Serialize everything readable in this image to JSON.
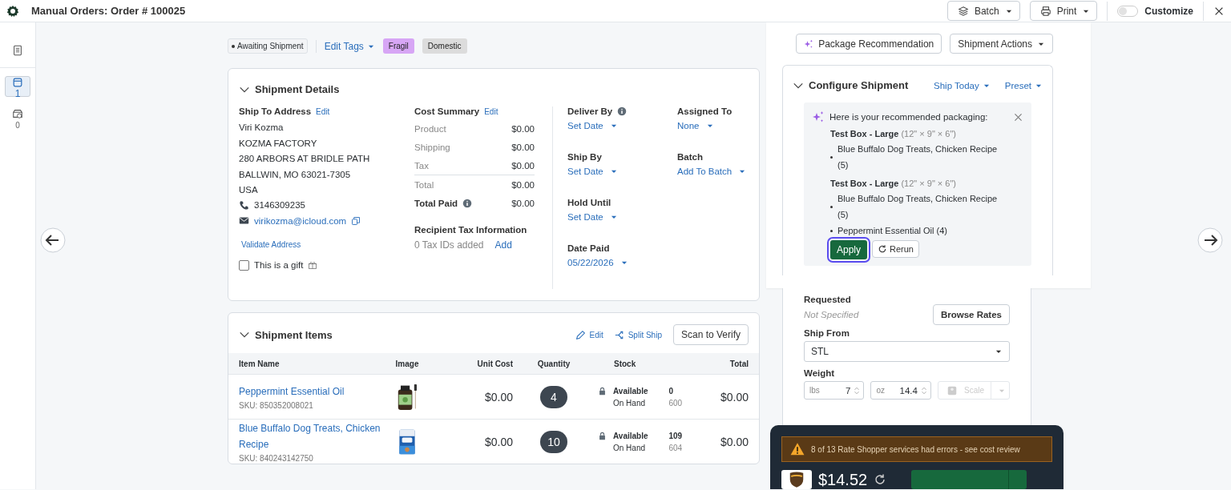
{
  "header": {
    "prefix": "Manual Orders:",
    "title": "Order # 100025",
    "buttons": [
      {
        "kind": "batch",
        "label": "Batch"
      },
      {
        "kind": "print",
        "label": "Print"
      }
    ],
    "customize": {
      "label": "Customize",
      "on": false
    }
  },
  "nav": [
    {
      "kind": "document",
      "selected": false
    },
    {
      "kind": "calendar",
      "count": "1",
      "selected": true
    },
    {
      "kind": "return",
      "count": "0",
      "selected": false
    }
  ],
  "status": "Awaiting Shipment",
  "edit_tags": "Edit Tags",
  "tags": [
    {
      "label": "Fragil",
      "color": "#d7a6f5"
    },
    {
      "label": "Domestic",
      "color": "#dcdcdc"
    }
  ],
  "shipment_details": {
    "title": "Shipment Details",
    "ship_to": {
      "label": "Ship To Address",
      "edit": "Edit",
      "lines": [
        "Viri Kozma",
        "KOZMA FACTORY",
        "280 ARBORS AT BRIDLE PATH",
        "BALLWIN, MO 63021-7305",
        "USA"
      ],
      "phone": "3146309235",
      "email": "virikozma@icloud.com",
      "validate": "Validate Address"
    },
    "gift": {
      "label": "This is a gift",
      "checked": false
    },
    "cost": {
      "label": "Cost Summary",
      "edit": "Edit",
      "rows": [
        {
          "label": "Product",
          "value": "$0.00",
          "kind": "line"
        },
        {
          "label": "Shipping",
          "value": "$0.00",
          "kind": "line"
        },
        {
          "label": "Tax",
          "value": "$0.00",
          "kind": "line"
        },
        {
          "label": "Total",
          "value": "$0.00",
          "kind": "total"
        },
        {
          "label": "Total Paid",
          "value": "$0.00",
          "kind": "paid"
        }
      ]
    },
    "tax": {
      "label": "Recipient Tax Information",
      "text": "0 Tax IDs added",
      "link": "Add"
    },
    "dates": [
      {
        "label": "Deliver By",
        "value": "Set Date",
        "info": true
      },
      {
        "label": "Ship By",
        "value": "Set Date",
        "info": false
      },
      {
        "label": "Hold Until",
        "value": "Set Date",
        "info": false
      },
      {
        "label": "Date Paid",
        "value": "05/22/2026",
        "info": false
      }
    ],
    "assign": [
      {
        "label": "Assigned To",
        "value": "None"
      },
      {
        "label": "Batch",
        "value": "Add To Batch"
      }
    ]
  },
  "items": {
    "title": "Shipment Items",
    "edit": "Edit",
    "split": "Split Ship",
    "scan": "Scan to Verify",
    "columns": [
      "Item Name",
      "Image",
      "Unit Cost",
      "Quantity",
      "Stock",
      "Total"
    ],
    "rows": [
      {
        "name": "Peppermint Essential Oil",
        "sku": "SKU: 850352008021",
        "unit_cost": "$0.00",
        "quantity": "4",
        "available_label": "Available",
        "available": "0",
        "on_hand_label": "On Hand",
        "on_hand": "600",
        "total": "$0.00"
      },
      {
        "name": "Blue Buffalo Dog Treats, Chicken Recipe",
        "sku": "SKU: 840243142750",
        "unit_cost": "$0.00",
        "quantity": "10",
        "available_label": "Available",
        "available": "109",
        "on_hand_label": "On Hand",
        "on_hand": "604",
        "total": "$0.00"
      }
    ]
  },
  "right": {
    "package_recommendation": "Package Recommendation",
    "shipment_actions": "Shipment Actions",
    "configure": {
      "title": "Configure Shipment",
      "ship_today": "Ship Today",
      "preset": "Preset"
    },
    "recommendation": {
      "heading": "Here is your recommended packaging:",
      "boxes": [
        {
          "name": "Test Box - Large",
          "dims": "(12\" × 9\" × 6\")",
          "items": [
            "Blue Buffalo Dog Treats, Chicken Recipe (5)"
          ]
        },
        {
          "name": "Test Box - Large",
          "dims": "(12\" × 9\" × 6\")",
          "items": [
            "Blue Buffalo Dog Treats, Chicken Recipe (5)",
            "Peppermint Essential Oil (4)"
          ]
        }
      ],
      "apply": {
        "label": "Apply",
        "focused": true
      },
      "rerun": "Rerun"
    },
    "requested": {
      "label": "Requested",
      "value": "Not Specified",
      "button": "Browse Rates"
    },
    "ship_from": {
      "label": "Ship From",
      "value": "STL"
    },
    "weight": {
      "label": "Weight",
      "lbs_unit": "lbs",
      "lbs": "7",
      "oz_unit": "oz",
      "oz": "14.4",
      "scale": {
        "label": "Scale",
        "disabled": true
      }
    },
    "rates": {
      "warning": "8 of 13 Rate Shopper services had errors - see cost review",
      "price": "$14.52"
    }
  }
}
